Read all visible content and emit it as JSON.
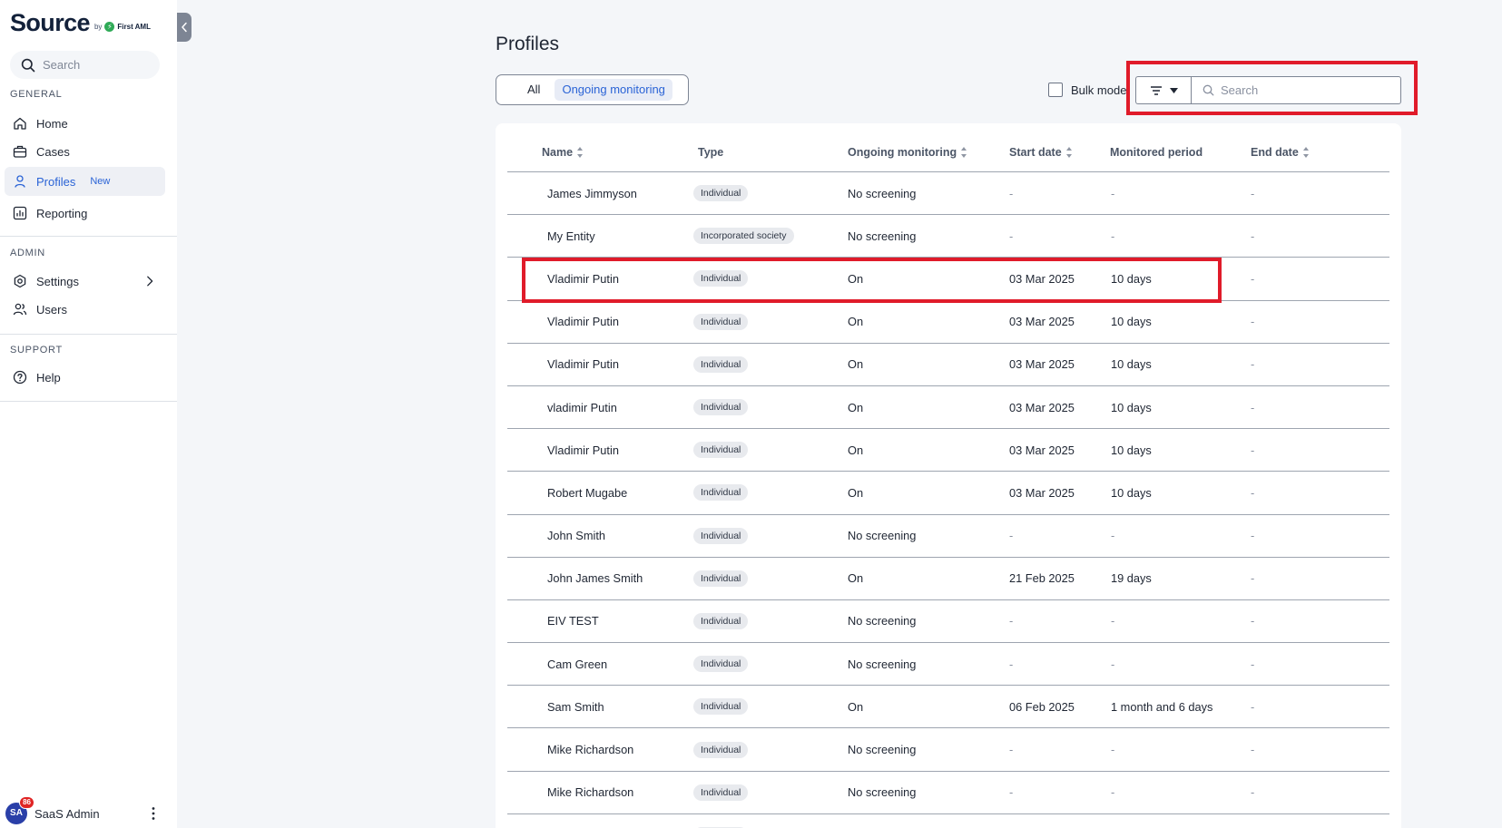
{
  "app": {
    "logo_text": "Source",
    "logo_by": "by",
    "logo_brand": "First AML"
  },
  "sidebar": {
    "search_placeholder": "Search",
    "sections": {
      "general": "GENERAL",
      "admin": "ADMIN",
      "support": "SUPPORT"
    },
    "items": {
      "home": "Home",
      "cases": "Cases",
      "profiles": "Profiles",
      "profiles_badge": "New",
      "reporting": "Reporting",
      "settings": "Settings",
      "users": "Users",
      "help": "Help"
    },
    "user": {
      "initials": "SA",
      "notifications": "86",
      "name": "SaaS Admin"
    }
  },
  "main": {
    "title": "Profiles",
    "tabs": [
      {
        "label": "All",
        "selected": false
      },
      {
        "label": "Ongoing monitoring",
        "selected": true
      }
    ],
    "bulk_mode_label": "Bulk mode",
    "search_placeholder": "Search",
    "columns": [
      "Name",
      "Type",
      "Ongoing monitoring",
      "Start date",
      "Monitored period",
      "End date"
    ],
    "rows": [
      {
        "name": "James Jimmyson",
        "type": "Individual",
        "monitoring": "No screening",
        "start": "-",
        "period": "-",
        "end": "-"
      },
      {
        "name": "My Entity",
        "type": "Incorporated society",
        "monitoring": "No screening",
        "start": "-",
        "period": "-",
        "end": "-"
      },
      {
        "name": "Vladimir Putin",
        "type": "Individual",
        "monitoring": "On",
        "start": "03 Mar 2025",
        "period": "10 days",
        "end": "-"
      },
      {
        "name": "Vladimir Putin",
        "type": "Individual",
        "monitoring": "On",
        "start": "03 Mar 2025",
        "period": "10 days",
        "end": "-"
      },
      {
        "name": "Vladimir Putin",
        "type": "Individual",
        "monitoring": "On",
        "start": "03 Mar 2025",
        "period": "10 days",
        "end": "-"
      },
      {
        "name": "vladimir Putin",
        "type": "Individual",
        "monitoring": "On",
        "start": "03 Mar 2025",
        "period": "10 days",
        "end": "-"
      },
      {
        "name": "Vladimir Putin",
        "type": "Individual",
        "monitoring": "On",
        "start": "03 Mar 2025",
        "period": "10 days",
        "end": "-"
      },
      {
        "name": "Robert Mugabe",
        "type": "Individual",
        "monitoring": "On",
        "start": "03 Mar 2025",
        "period": "10 days",
        "end": "-"
      },
      {
        "name": "John Smith",
        "type": "Individual",
        "monitoring": "No screening",
        "start": "-",
        "period": "-",
        "end": "-"
      },
      {
        "name": "John James Smith",
        "type": "Individual",
        "monitoring": "On",
        "start": "21 Feb 2025",
        "period": "19 days",
        "end": "-"
      },
      {
        "name": "EIV TEST",
        "type": "Individual",
        "monitoring": "No screening",
        "start": "-",
        "period": "-",
        "end": "-"
      },
      {
        "name": "Cam Green",
        "type": "Individual",
        "monitoring": "No screening",
        "start": "-",
        "period": "-",
        "end": "-"
      },
      {
        "name": "Sam Smith",
        "type": "Individual",
        "monitoring": "On",
        "start": "06 Feb 2025",
        "period": "1 month and 6 days",
        "end": "-"
      },
      {
        "name": "Mike Richardson",
        "type": "Individual",
        "monitoring": "No screening",
        "start": "-",
        "period": "-",
        "end": "-"
      },
      {
        "name": "Mike Richardson",
        "type": "Individual",
        "monitoring": "No screening",
        "start": "-",
        "period": "-",
        "end": "-"
      },
      {
        "name": "",
        "type": "Individual",
        "monitoring": "",
        "start": "",
        "period": "",
        "end": ""
      }
    ]
  },
  "colors": {
    "accent": "#2a63d6",
    "highlight": "#e01b2a",
    "background": "#f4f6f9"
  }
}
